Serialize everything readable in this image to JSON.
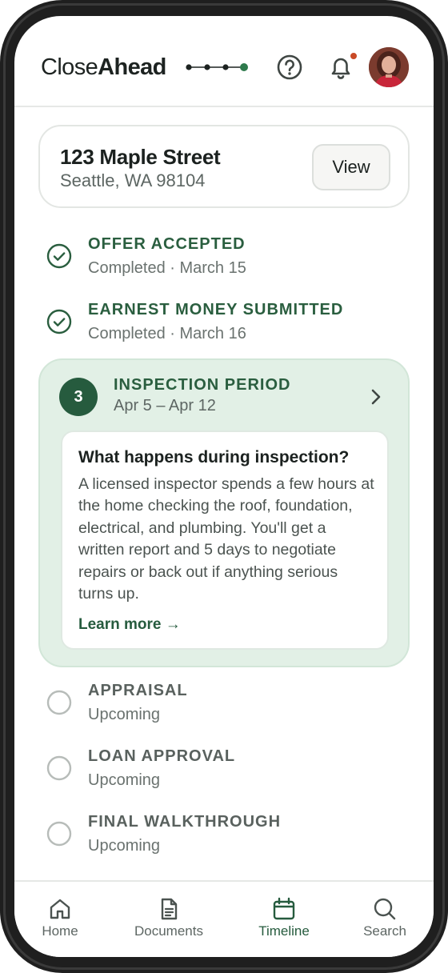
{
  "app": {
    "brand_light": "Close",
    "brand_bold": "Ahead"
  },
  "header": {
    "help_icon": "help-circle-icon",
    "bell_icon": "bell-icon",
    "has_notification": true,
    "progress_dots_total": 4,
    "progress_dots_current": 4
  },
  "property": {
    "address_line1": "123 Maple Street",
    "address_line2": "Seattle, WA 98104",
    "view_label": "View"
  },
  "timeline": {
    "completed": [
      {
        "title": "OFFER ACCEPTED",
        "subtitle": "Completed · March 15"
      },
      {
        "title": "EARNEST MONEY SUBMITTED",
        "subtitle": "Completed · March 16"
      }
    ],
    "current": {
      "number": "3",
      "title": "INSPECTION PERIOD",
      "dates": "Apr 5 – Apr 12",
      "info_heading": "What happens during inspection?",
      "info_body": "A licensed inspector spends a few hours at the home checking the roof, foundation, electrical, and plumbing. You'll get a written report and 5 days to negotiate repairs or back out if anything serious turns up.",
      "learn_more": "Learn more →"
    },
    "upcoming": [
      {
        "title": "APPRAISAL",
        "subtitle": "Upcoming"
      },
      {
        "title": "LOAN APPROVAL",
        "subtitle": "Upcoming"
      },
      {
        "title": "FINAL WALKTHROUGH",
        "subtitle": "Upcoming"
      }
    ]
  },
  "nav": {
    "items": [
      {
        "label": "Home",
        "icon": "home-icon",
        "active": false
      },
      {
        "label": "Documents",
        "icon": "document-icon",
        "active": false
      },
      {
        "label": "Timeline",
        "icon": "calendar-icon",
        "active": true
      },
      {
        "label": "Search",
        "icon": "search-icon",
        "active": false
      }
    ]
  },
  "colors": {
    "brand_green": "#265b3e",
    "completed_green": "#2a5e3f",
    "current_bg": "#e2f0e6",
    "notification": "#c94a26",
    "muted_text": "#5d6663"
  }
}
